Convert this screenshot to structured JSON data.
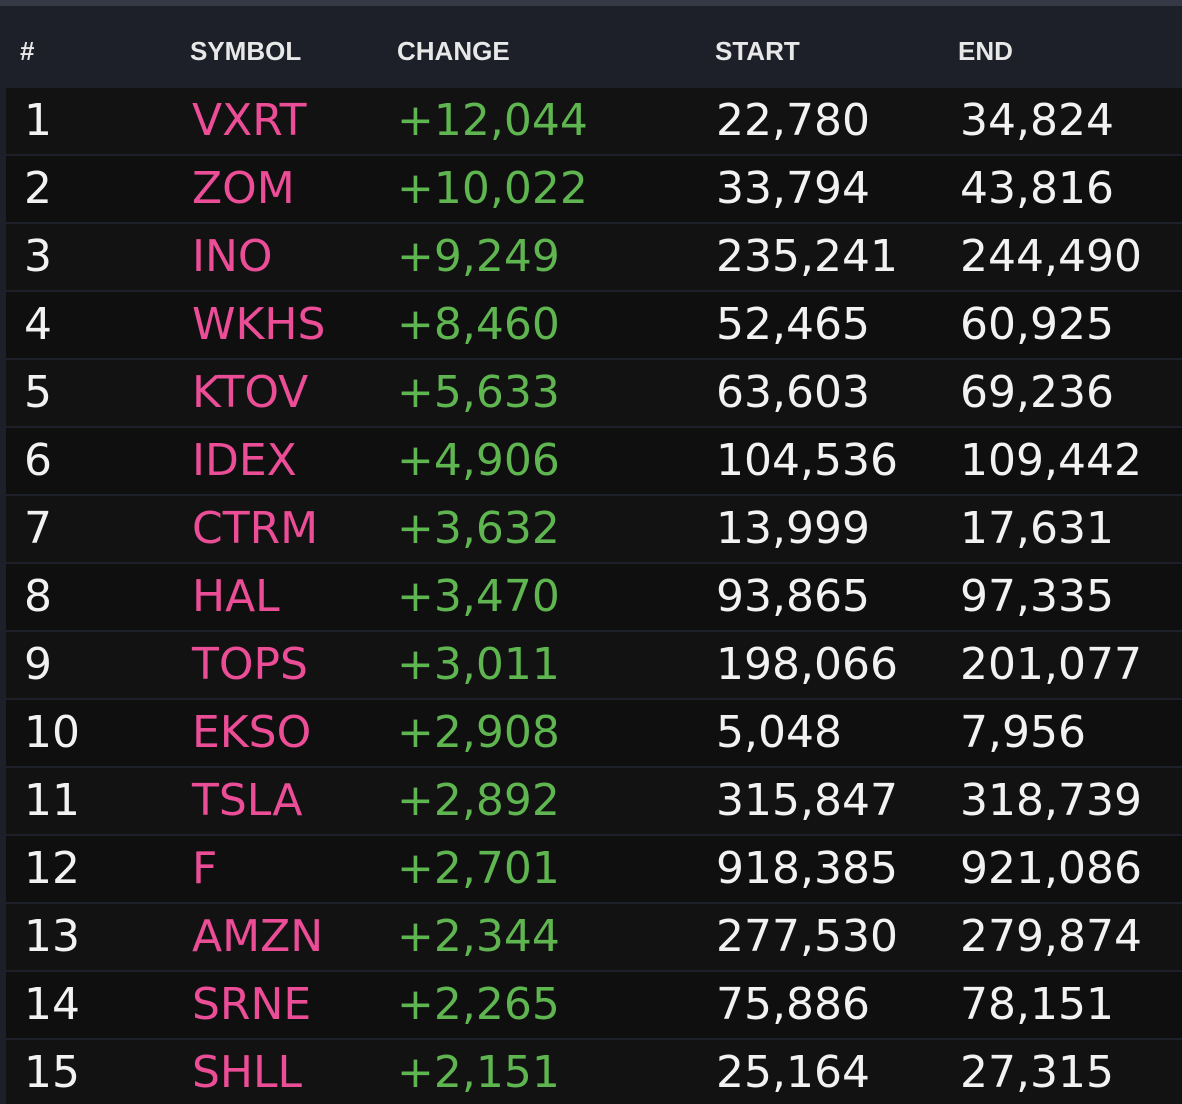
{
  "table": {
    "headers": {
      "rank": "#",
      "symbol": "SYMBOL",
      "change": "CHANGE",
      "start": "START",
      "end": "END"
    },
    "rows": [
      {
        "rank": "1",
        "symbol": "VXRT",
        "change": "+12,044",
        "start": "22,780",
        "end": "34,824"
      },
      {
        "rank": "2",
        "symbol": "ZOM",
        "change": "+10,022",
        "start": "33,794",
        "end": "43,816"
      },
      {
        "rank": "3",
        "symbol": "INO",
        "change": "+9,249",
        "start": "235,241",
        "end": "244,490"
      },
      {
        "rank": "4",
        "symbol": "WKHS",
        "change": "+8,460",
        "start": "52,465",
        "end": "60,925"
      },
      {
        "rank": "5",
        "symbol": "KTOV",
        "change": "+5,633",
        "start": "63,603",
        "end": "69,236"
      },
      {
        "rank": "6",
        "symbol": "IDEX",
        "change": "+4,906",
        "start": "104,536",
        "end": "109,442"
      },
      {
        "rank": "7",
        "symbol": "CTRM",
        "change": "+3,632",
        "start": "13,999",
        "end": "17,631"
      },
      {
        "rank": "8",
        "symbol": "HAL",
        "change": "+3,470",
        "start": "93,865",
        "end": "97,335"
      },
      {
        "rank": "9",
        "symbol": "TOPS",
        "change": "+3,011",
        "start": "198,066",
        "end": "201,077"
      },
      {
        "rank": "10",
        "symbol": "EKSO",
        "change": "+2,908",
        "start": "5,048",
        "end": "7,956"
      },
      {
        "rank": "11",
        "symbol": "TSLA",
        "change": "+2,892",
        "start": "315,847",
        "end": "318,739"
      },
      {
        "rank": "12",
        "symbol": "F",
        "change": "+2,701",
        "start": "918,385",
        "end": "921,086"
      },
      {
        "rank": "13",
        "symbol": "AMZN",
        "change": "+2,344",
        "start": "277,530",
        "end": "279,874"
      },
      {
        "rank": "14",
        "symbol": "SRNE",
        "change": "+2,265",
        "start": "75,886",
        "end": "78,151"
      },
      {
        "rank": "15",
        "symbol": "SHLL",
        "change": "+2,151",
        "start": "25,164",
        "end": "27,315"
      }
    ]
  },
  "colors": {
    "background": "#1d2028",
    "row_background": "#0f0f10",
    "symbol": "#ec4d97",
    "change_positive": "#5fb54f",
    "text": "#f2f2f2"
  }
}
